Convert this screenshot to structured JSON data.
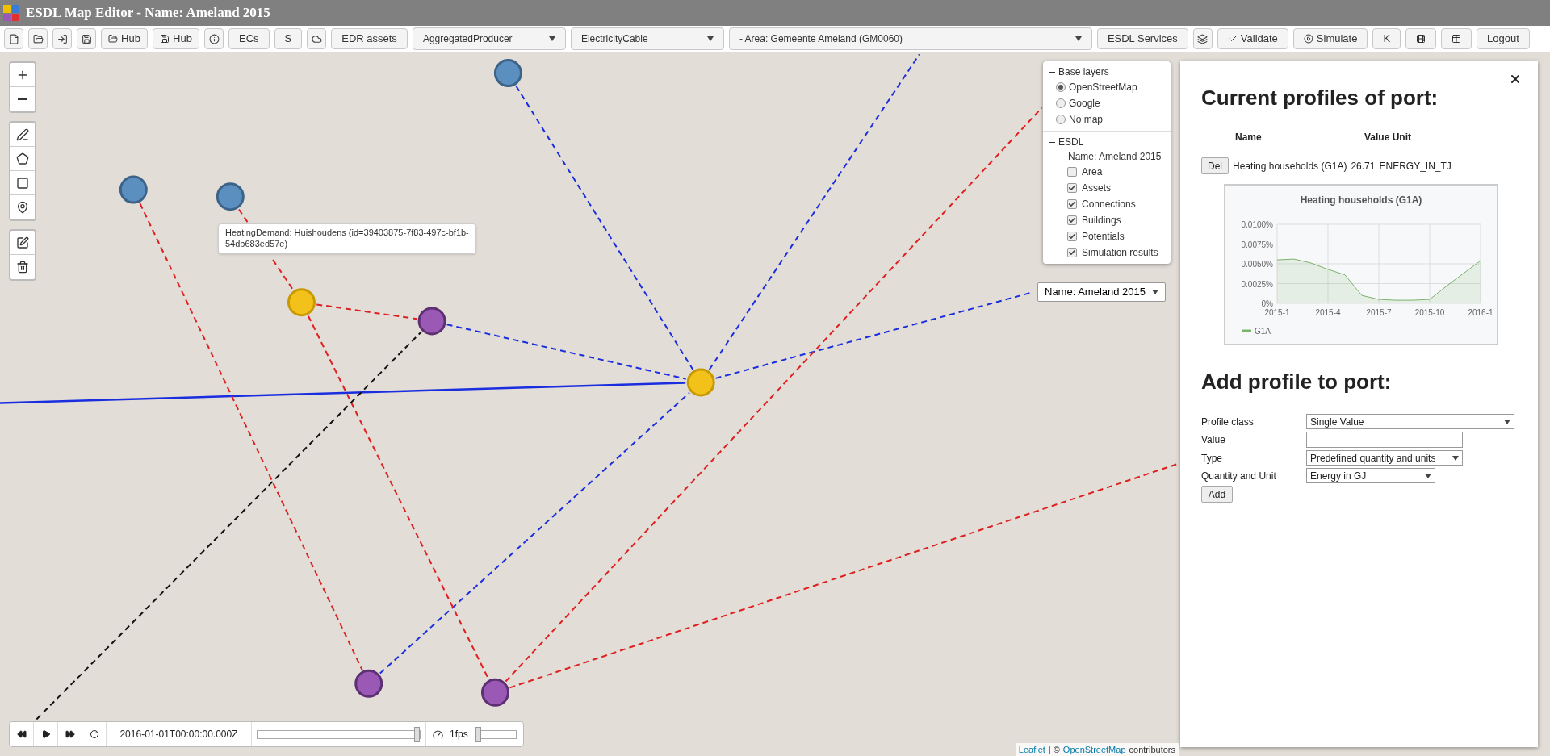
{
  "window": {
    "title": "ESDL Map Editor - Name: Ameland 2015"
  },
  "toolbar": {
    "hub_buttons": [
      "Hub",
      "Hub"
    ],
    "text_buttons": [
      "ECs",
      "S"
    ],
    "edr_button": "EDR assets",
    "dropdowns": [
      {
        "value": "AggregatedProducer"
      },
      {
        "value": "ElectricityCable"
      },
      {
        "value": "- Area: Gemeente Ameland (GM0060)"
      }
    ],
    "services_button": "ESDL Services",
    "validate_button": "Validate",
    "simulate_button": "Simulate",
    "k_button": "K",
    "logout_button": "Logout"
  },
  "tooltip": "HeatingDemand: Huishoudens (id=39403875-7f83-497c-bf1b-54db683ed57e)",
  "layers": {
    "base_title": "Base layers",
    "base_options": [
      {
        "label": "OpenStreetMap",
        "selected": true
      },
      {
        "label": "Google",
        "selected": false
      },
      {
        "label": "No map",
        "selected": false
      }
    ],
    "esdl_title": "ESDL",
    "energy_system": "Name: Ameland 2015",
    "overlays": [
      {
        "label": "Area",
        "checked": false
      },
      {
        "label": "Assets",
        "checked": true
      },
      {
        "label": "Connections",
        "checked": true
      },
      {
        "label": "Buildings",
        "checked": true
      },
      {
        "label": "Potentials",
        "checked": true
      },
      {
        "label": "Simulation results",
        "checked": true
      }
    ]
  },
  "system_select": {
    "value": "Name: Ameland 2015"
  },
  "panel": {
    "title": "Current profiles of port:",
    "columns": [
      "Name",
      "Value Unit"
    ],
    "profiles": [
      {
        "button": "Del",
        "name": "Heating households (G1A)",
        "value": "26.71",
        "unit": "ENERGY_IN_TJ"
      }
    ],
    "chart_data": {
      "type": "area",
      "title": "Heating households (G1A)",
      "categories": [
        "2015-1",
        null,
        null,
        "2015-4",
        null,
        null,
        "2015-7",
        null,
        null,
        "2015-10",
        null,
        null,
        "2016-1"
      ],
      "series": [
        {
          "name": "G1A",
          "color": "#7cb36b",
          "values": [
            0.0055,
            0.0056,
            0.0051,
            0.0043,
            0.0036,
            0.001,
            0.0005,
            0.0004,
            0.0004,
            0.0005,
            0.0022,
            0.0038,
            0.0054
          ]
        }
      ],
      "ylim": [
        0,
        0.01
      ],
      "grid": true,
      "yticks": [
        {
          "value": 0,
          "label": "0%"
        },
        {
          "value": 0.0025,
          "label": "0.0025%"
        },
        {
          "value": 0.005,
          "label": "0.0050%"
        },
        {
          "value": 0.0075,
          "label": "0.0075%"
        },
        {
          "value": 0.01,
          "label": "0.0100%"
        }
      ]
    },
    "add_title": "Add profile to port:",
    "form": [
      {
        "label": "Profile class",
        "kind": "select",
        "value": "Single Value"
      },
      {
        "label": "Value",
        "kind": "input"
      },
      {
        "label": "Type",
        "kind": "select",
        "value": "Predefined quantity and units"
      },
      {
        "label": "Quantity and Unit",
        "kind": "select",
        "value": "Energy in GJ"
      }
    ],
    "add_button": "Add"
  },
  "timeline": {
    "time": "2016-01-01T00:00:00.000Z",
    "position": {
      "level": 1
    },
    "speed": {
      "label": "1fps",
      "level": 0
    }
  },
  "attribution": {
    "links": [
      "Leaflet",
      "OpenStreetMap"
    ],
    "separator": "| ©",
    "tail": "contributors"
  }
}
